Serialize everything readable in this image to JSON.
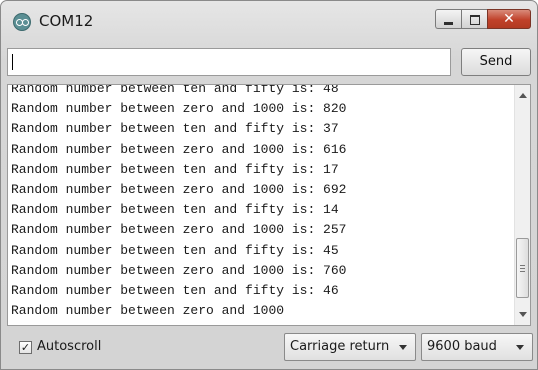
{
  "window": {
    "title": "COM12",
    "icon": "arduino-icon"
  },
  "title_buttons": {
    "minimize_icon": "minimize-icon",
    "maximize_icon": "maximize-icon",
    "close_icon": "close-icon",
    "close_glyph": "✕"
  },
  "input": {
    "value": "",
    "placeholder": ""
  },
  "send_button": {
    "label": "Send"
  },
  "output_lines": [
    "Random number between ten and fifty is: 48",
    "Random number between zero and 1000 is: 820",
    "Random number between ten and fifty is: 37",
    "Random number between zero and 1000 is: 616",
    "Random number between ten and fifty is: 17",
    "Random number between zero and 1000 is: 692",
    "Random number between ten and fifty is: 14",
    "Random number between zero and 1000 is: 257",
    "Random number between ten and fifty is: 45",
    "Random number between zero and 1000 is: 760",
    "Random number between ten and fifty is: 46",
    "Random number between zero and 1000"
  ],
  "autoscroll": {
    "label": "Autoscroll",
    "checked": true,
    "check_glyph": "✓"
  },
  "line_ending": {
    "selected": "Carriage return"
  },
  "baud": {
    "selected": "9600 baud"
  },
  "colors": {
    "close_button": "#c0412a",
    "window_bg": "#d6d6d6"
  }
}
